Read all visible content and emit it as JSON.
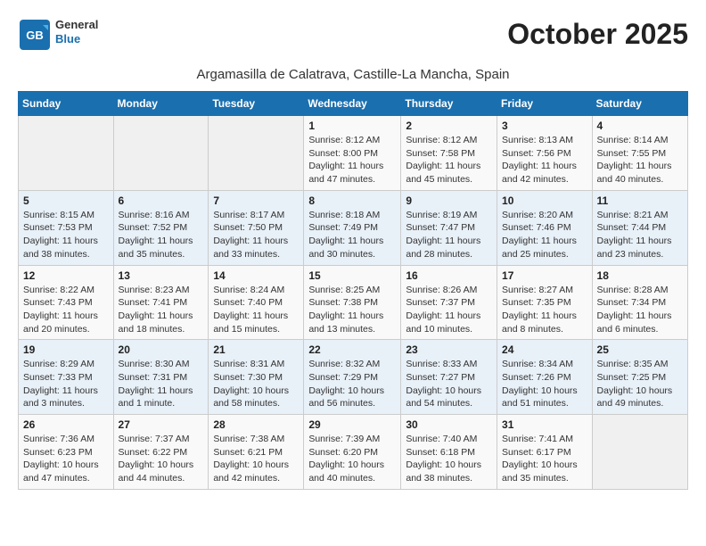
{
  "logo": {
    "general": "General",
    "blue": "Blue"
  },
  "title": "October 2025",
  "location": "Argamasilla de Calatrava, Castille-La Mancha, Spain",
  "days_of_week": [
    "Sunday",
    "Monday",
    "Tuesday",
    "Wednesday",
    "Thursday",
    "Friday",
    "Saturday"
  ],
  "weeks": [
    [
      {
        "day": "",
        "info": ""
      },
      {
        "day": "",
        "info": ""
      },
      {
        "day": "",
        "info": ""
      },
      {
        "day": "1",
        "info": "Sunrise: 8:12 AM\nSunset: 8:00 PM\nDaylight: 11 hours and 47 minutes."
      },
      {
        "day": "2",
        "info": "Sunrise: 8:12 AM\nSunset: 7:58 PM\nDaylight: 11 hours and 45 minutes."
      },
      {
        "day": "3",
        "info": "Sunrise: 8:13 AM\nSunset: 7:56 PM\nDaylight: 11 hours and 42 minutes."
      },
      {
        "day": "4",
        "info": "Sunrise: 8:14 AM\nSunset: 7:55 PM\nDaylight: 11 hours and 40 minutes."
      }
    ],
    [
      {
        "day": "5",
        "info": "Sunrise: 8:15 AM\nSunset: 7:53 PM\nDaylight: 11 hours and 38 minutes."
      },
      {
        "day": "6",
        "info": "Sunrise: 8:16 AM\nSunset: 7:52 PM\nDaylight: 11 hours and 35 minutes."
      },
      {
        "day": "7",
        "info": "Sunrise: 8:17 AM\nSunset: 7:50 PM\nDaylight: 11 hours and 33 minutes."
      },
      {
        "day": "8",
        "info": "Sunrise: 8:18 AM\nSunset: 7:49 PM\nDaylight: 11 hours and 30 minutes."
      },
      {
        "day": "9",
        "info": "Sunrise: 8:19 AM\nSunset: 7:47 PM\nDaylight: 11 hours and 28 minutes."
      },
      {
        "day": "10",
        "info": "Sunrise: 8:20 AM\nSunset: 7:46 PM\nDaylight: 11 hours and 25 minutes."
      },
      {
        "day": "11",
        "info": "Sunrise: 8:21 AM\nSunset: 7:44 PM\nDaylight: 11 hours and 23 minutes."
      }
    ],
    [
      {
        "day": "12",
        "info": "Sunrise: 8:22 AM\nSunset: 7:43 PM\nDaylight: 11 hours and 20 minutes."
      },
      {
        "day": "13",
        "info": "Sunrise: 8:23 AM\nSunset: 7:41 PM\nDaylight: 11 hours and 18 minutes."
      },
      {
        "day": "14",
        "info": "Sunrise: 8:24 AM\nSunset: 7:40 PM\nDaylight: 11 hours and 15 minutes."
      },
      {
        "day": "15",
        "info": "Sunrise: 8:25 AM\nSunset: 7:38 PM\nDaylight: 11 hours and 13 minutes."
      },
      {
        "day": "16",
        "info": "Sunrise: 8:26 AM\nSunset: 7:37 PM\nDaylight: 11 hours and 10 minutes."
      },
      {
        "day": "17",
        "info": "Sunrise: 8:27 AM\nSunset: 7:35 PM\nDaylight: 11 hours and 8 minutes."
      },
      {
        "day": "18",
        "info": "Sunrise: 8:28 AM\nSunset: 7:34 PM\nDaylight: 11 hours and 6 minutes."
      }
    ],
    [
      {
        "day": "19",
        "info": "Sunrise: 8:29 AM\nSunset: 7:33 PM\nDaylight: 11 hours and 3 minutes."
      },
      {
        "day": "20",
        "info": "Sunrise: 8:30 AM\nSunset: 7:31 PM\nDaylight: 11 hours and 1 minute."
      },
      {
        "day": "21",
        "info": "Sunrise: 8:31 AM\nSunset: 7:30 PM\nDaylight: 10 hours and 58 minutes."
      },
      {
        "day": "22",
        "info": "Sunrise: 8:32 AM\nSunset: 7:29 PM\nDaylight: 10 hours and 56 minutes."
      },
      {
        "day": "23",
        "info": "Sunrise: 8:33 AM\nSunset: 7:27 PM\nDaylight: 10 hours and 54 minutes."
      },
      {
        "day": "24",
        "info": "Sunrise: 8:34 AM\nSunset: 7:26 PM\nDaylight: 10 hours and 51 minutes."
      },
      {
        "day": "25",
        "info": "Sunrise: 8:35 AM\nSunset: 7:25 PM\nDaylight: 10 hours and 49 minutes."
      }
    ],
    [
      {
        "day": "26",
        "info": "Sunrise: 7:36 AM\nSunset: 6:23 PM\nDaylight: 10 hours and 47 minutes."
      },
      {
        "day": "27",
        "info": "Sunrise: 7:37 AM\nSunset: 6:22 PM\nDaylight: 10 hours and 44 minutes."
      },
      {
        "day": "28",
        "info": "Sunrise: 7:38 AM\nSunset: 6:21 PM\nDaylight: 10 hours and 42 minutes."
      },
      {
        "day": "29",
        "info": "Sunrise: 7:39 AM\nSunset: 6:20 PM\nDaylight: 10 hours and 40 minutes."
      },
      {
        "day": "30",
        "info": "Sunrise: 7:40 AM\nSunset: 6:18 PM\nDaylight: 10 hours and 38 minutes."
      },
      {
        "day": "31",
        "info": "Sunrise: 7:41 AM\nSunset: 6:17 PM\nDaylight: 10 hours and 35 minutes."
      },
      {
        "day": "",
        "info": ""
      }
    ]
  ]
}
